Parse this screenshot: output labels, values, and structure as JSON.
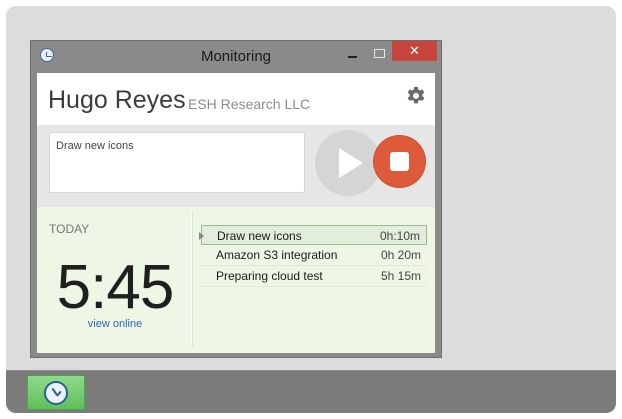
{
  "window": {
    "title": "Monitoring",
    "close_label": "✕"
  },
  "header": {
    "user_name": "Hugo Reyes",
    "company": "ESH Research LLC"
  },
  "task_input": {
    "value": "Draw new icons"
  },
  "today": {
    "label": "TODAY",
    "time": "5:45",
    "view_online": "view online"
  },
  "tasks": [
    {
      "name": "Draw new icons",
      "duration": "0h:10m",
      "selected": true
    },
    {
      "name": "Amazon S3 integration",
      "duration": "0h 20m",
      "selected": false
    },
    {
      "name": "Preparing cloud test",
      "duration": "5h 15m",
      "selected": false
    }
  ],
  "colors": {
    "stop_button": "#dd5a3b",
    "close_button": "#c7463c",
    "today_panel": "#eef6e5",
    "taskbar_app": "#6fc86b"
  },
  "icons": [
    "app-clock-icon",
    "gear-icon",
    "play-icon",
    "stop-icon",
    "close-icon",
    "minimize-icon",
    "maximize-icon"
  ]
}
